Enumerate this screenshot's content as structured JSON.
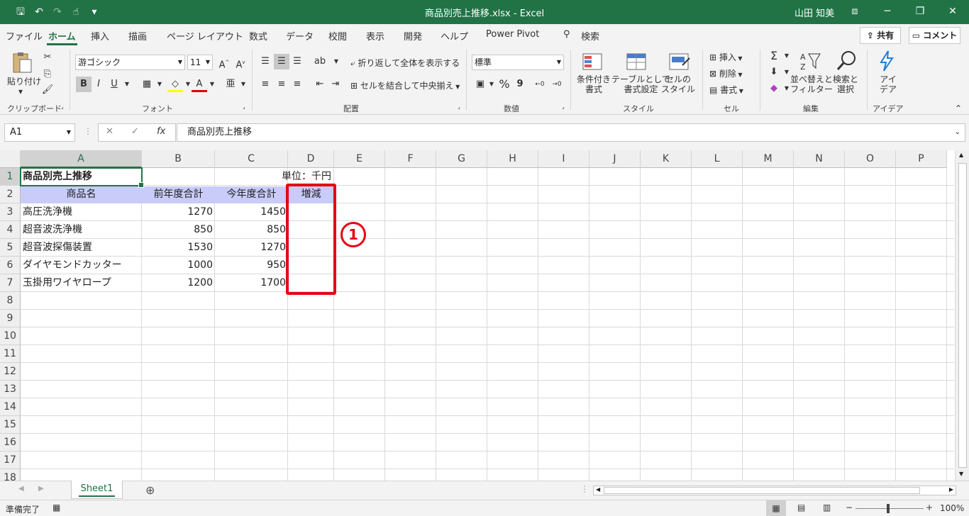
{
  "window": {
    "title": "商品別売上推移.xlsx  -  Excel",
    "user": "山田 知美"
  },
  "tabs": [
    "ファイル",
    "ホーム",
    "挿入",
    "描画",
    "ページ レイアウト",
    "数式",
    "データ",
    "校閲",
    "表示",
    "開発",
    "ヘルプ",
    "Power Pivot",
    "検索"
  ],
  "active_tab": "ホーム",
  "share_label": "共有",
  "comment_label": "コメント",
  "ribbon": {
    "clipboard": {
      "paste": "貼り付け",
      "label": "クリップボード"
    },
    "font": {
      "name": "游ゴシック",
      "size": "11",
      "bold": "B",
      "italic": "I",
      "underline": "U",
      "label": "フォント"
    },
    "alignment": {
      "wrap": "折り返して全体を表示する",
      "merge": "セルを結合して中央揃え",
      "label": "配置"
    },
    "number": {
      "format": "標準",
      "percent": "%",
      "comma": "9",
      "label": "数値"
    },
    "styles": {
      "conditional": "条件付き\n書式",
      "table": "テーブルとして\n書式設定",
      "cell": "セルの\nスタイル",
      "label": "スタイル"
    },
    "cells": {
      "insert": "挿入",
      "delete": "削除",
      "format": "書式",
      "label": "セル"
    },
    "editing": {
      "sort": "並べ替えと\nフィルター",
      "find": "検索と\n選択",
      "label": "編集"
    },
    "ideas": {
      "text": "アイ\nデア",
      "label": "アイデア"
    }
  },
  "formula_bar": {
    "name_box": "A1",
    "fx": "fx",
    "content": "商品別売上推移"
  },
  "columns": [
    "A",
    "B",
    "C",
    "D",
    "E",
    "F",
    "G",
    "H",
    "I",
    "J",
    "K",
    "L",
    "M",
    "N",
    "O",
    "P"
  ],
  "rows": [
    "1",
    "2",
    "3",
    "4",
    "5",
    "6",
    "7",
    "8",
    "9",
    "10",
    "11",
    "12",
    "13",
    "14",
    "15",
    "16",
    "17",
    "18"
  ],
  "cells": {
    "A1": "商品別売上推移",
    "D1": "単位：千円",
    "A2": "商品名",
    "B2": "前年度合計",
    "C2": "今年度合計",
    "D2": "増減",
    "data": [
      {
        "name": "高圧洗浄機",
        "prev": "1270",
        "curr": "1450"
      },
      {
        "name": "超音波洗浄機",
        "prev": "850",
        "curr": "850"
      },
      {
        "name": "超音波探傷装置",
        "prev": "1530",
        "curr": "1270"
      },
      {
        "name": "ダイヤモンドカッター",
        "prev": "1000",
        "curr": "950"
      },
      {
        "name": "玉掛用ワイヤロープ",
        "prev": "1200",
        "curr": "1700"
      }
    ]
  },
  "annotation": {
    "badge": "1",
    "color": "#e60012"
  },
  "sheet_tab": "Sheet1",
  "status": {
    "ready": "準備完了",
    "zoom": "100%"
  },
  "colors": {
    "accent": "#217346",
    "header_fill": "#c9cbf8"
  }
}
